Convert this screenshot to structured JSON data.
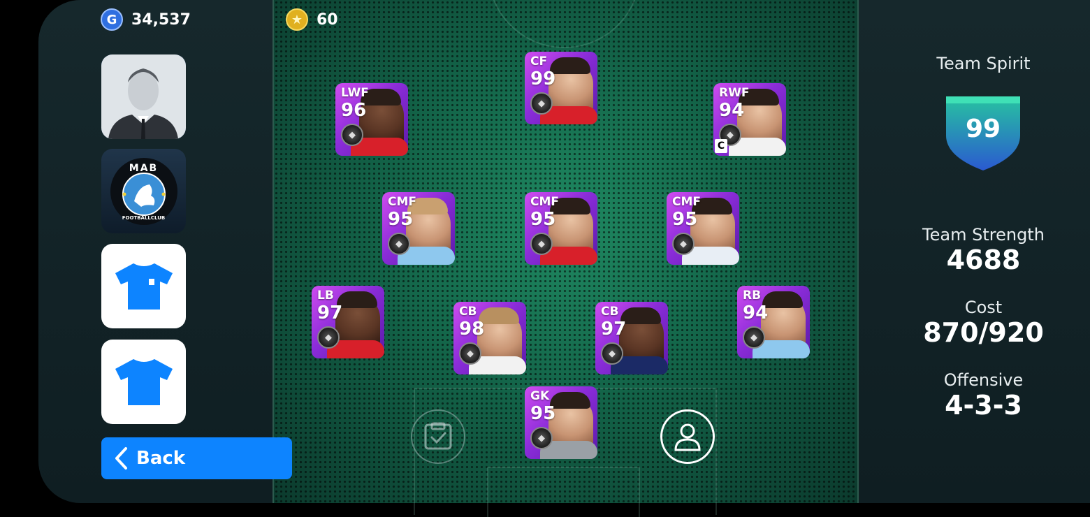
{
  "currency": {
    "gp_value": "34,537",
    "coins_value": "60"
  },
  "sidebar": {
    "back_label": "Back"
  },
  "players": [
    {
      "position": "CF",
      "rating": "99"
    },
    {
      "position": "LWF",
      "rating": "96"
    },
    {
      "position": "RWF",
      "rating": "94",
      "captain": "C"
    },
    {
      "position": "CMF",
      "rating": "95"
    },
    {
      "position": "CMF",
      "rating": "95"
    },
    {
      "position": "CMF",
      "rating": "95"
    },
    {
      "position": "LB",
      "rating": "97"
    },
    {
      "position": "CB",
      "rating": "98"
    },
    {
      "position": "CB",
      "rating": "97"
    },
    {
      "position": "RB",
      "rating": "94"
    },
    {
      "position": "GK",
      "rating": "95"
    }
  ],
  "emblem": {
    "top_text": "MAB",
    "bottom_text": "FOOTBALLCLUB"
  },
  "stats": {
    "team_spirit_label": "Team Spirit",
    "team_spirit_value": "99",
    "team_strength_label": "Team Strength",
    "team_strength_value": "4688",
    "cost_label": "Cost",
    "cost_value": "870/920",
    "playstyle_label": "Offensive",
    "formation_value": "4-3-3"
  },
  "colors": {
    "accent_blue": "#0d84ff",
    "card_purple": "#8a2cd8",
    "shield_teal": "#27c4a0"
  }
}
